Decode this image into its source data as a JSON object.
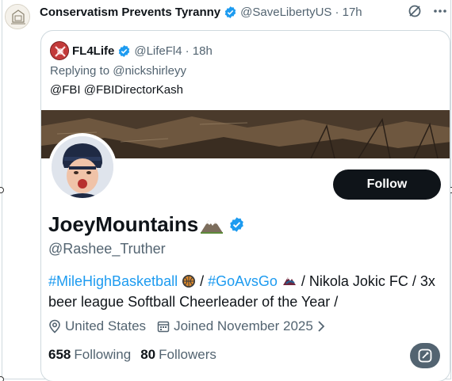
{
  "post": {
    "author_name": "Conservatism Prevents Tyranny",
    "author_handle": "@SaveLibertyUS",
    "time": "· 17h",
    "top_icons": [
      "grok-icon",
      "more-icon"
    ]
  },
  "quote": {
    "author_name": "FL4Life",
    "author_handle": "@LifeFl4",
    "time": "· 18h",
    "replying_prefix": "Replying to",
    "replying_to": "@nickshirleyy",
    "mentions": "@FBI @FBIDirectorKash"
  },
  "profile_card": {
    "display_name": "JoeyMountains",
    "handle": "@Rashee_Truther",
    "follow_label": "Follow",
    "bio": {
      "tag1": "#MileHighBasketball",
      "sep1": " / ",
      "tag2": "#GoAvsGo",
      "line_rest": " / Nikola Jokic FC / 3x beer league Softball Cheerleader of the Year /"
    },
    "location": "United States",
    "joined": "Joined November 2025",
    "following_count": "658",
    "following_label": "Following",
    "followers_count": "80",
    "followers_label": "Followers"
  },
  "colors": {
    "accent": "#1d9bf0",
    "text": "#0f1419",
    "muted": "#536471",
    "border": "#cfd9de"
  }
}
